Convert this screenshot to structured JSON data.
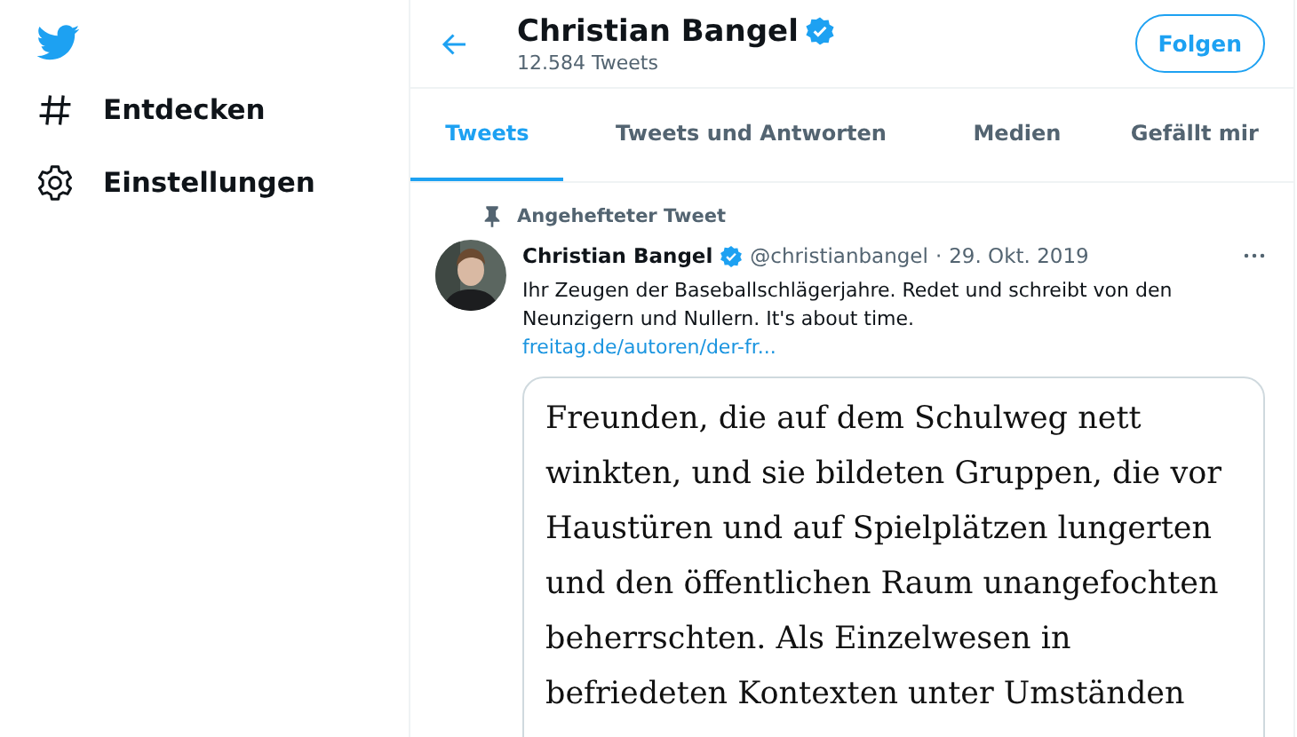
{
  "sidebar": {
    "items": [
      {
        "kind": "hashtag",
        "label": "Entdecken"
      },
      {
        "kind": "settings",
        "label": "Einstellungen"
      }
    ]
  },
  "header": {
    "name": "Christian Bangel",
    "verified": true,
    "tweet_count": "12.584 Tweets",
    "follow_button": "Folgen"
  },
  "tabs": [
    {
      "label": "Tweets",
      "selected": true
    },
    {
      "label": "Tweets und Antworten",
      "selected": false
    },
    {
      "label": "Medien",
      "selected": false
    },
    {
      "label": "Gefällt mir",
      "selected": false
    }
  ],
  "pinned_tweet": {
    "pinned_label": "Angehefteter Tweet",
    "name": "Christian Bangel",
    "verified": true,
    "handle": "@christianbangel",
    "separator": "·",
    "date": "29. Okt. 2019",
    "text": "Ihr Zeugen der Baseballschlägerjahre. Redet und schreibt von den Neunzigern und Nullern. It's about time.",
    "link": "freitag.de/autoren/der-fr...",
    "card_lines": [
      "Freunden, die auf dem Schulweg nett",
      "winkten, und sie bildeten Gruppen, die vor",
      "Haustüren und auf Spielplätzen lungerten",
      "und den öffentlichen Raum unangefochten",
      "beherrschten. Als Einzelwesen in",
      "befriedeten Kontexten unter Umständen"
    ]
  }
}
